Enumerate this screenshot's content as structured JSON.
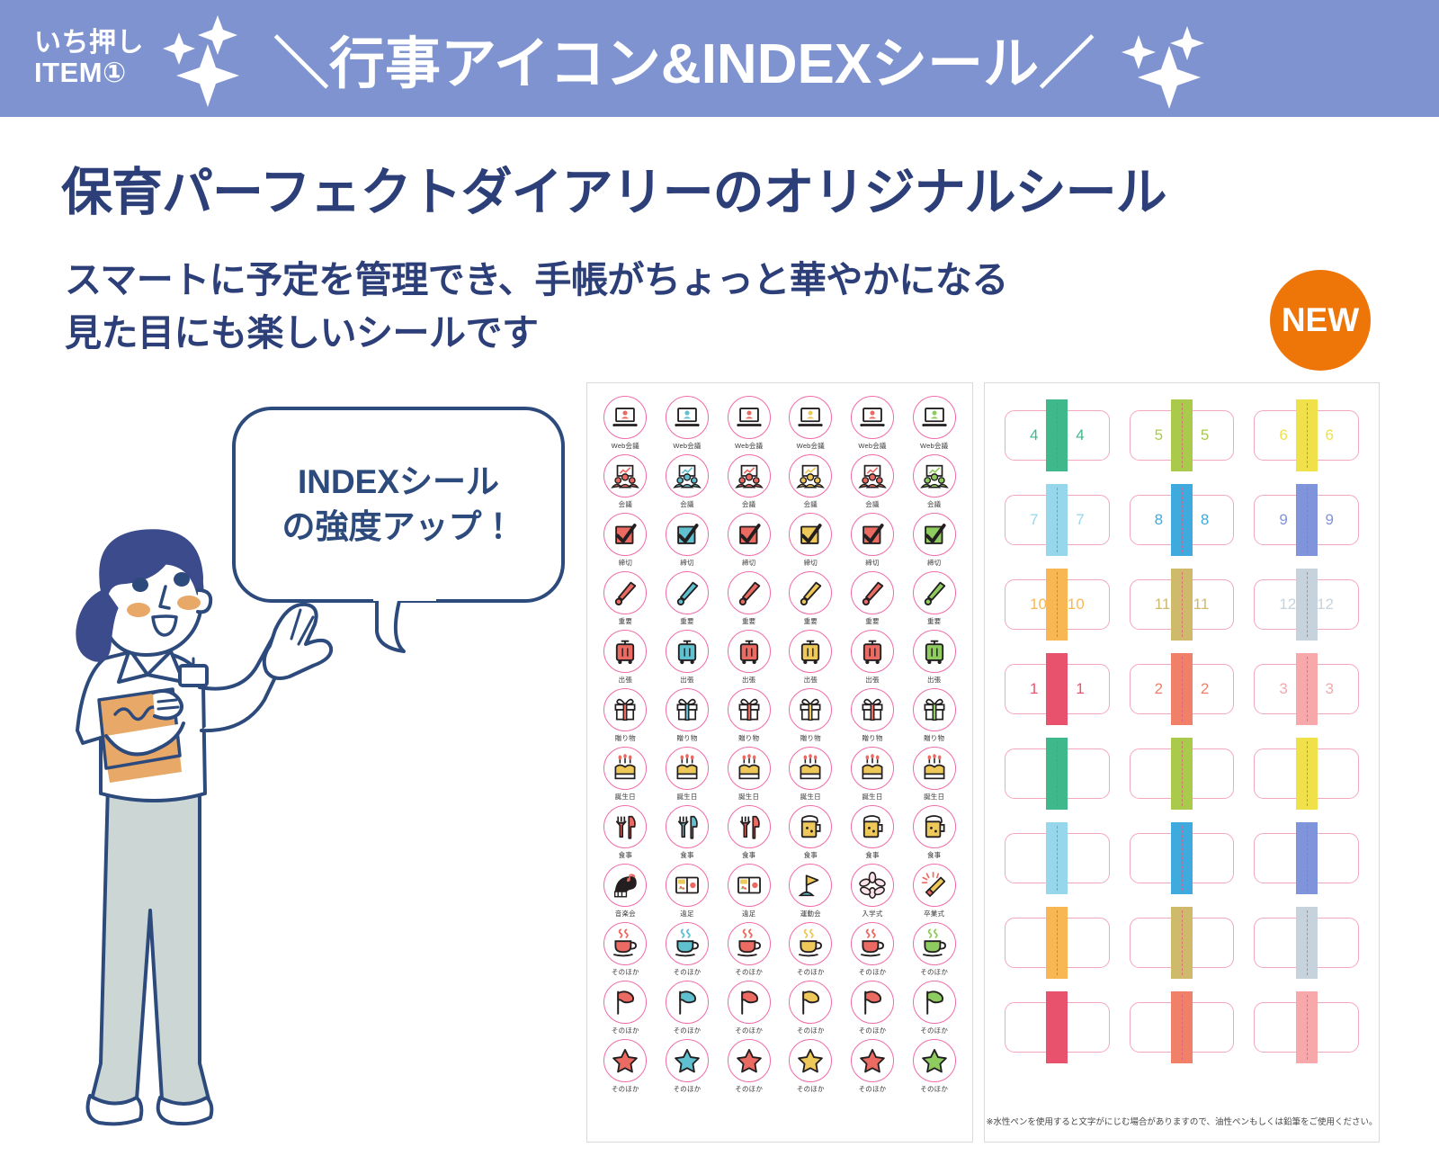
{
  "header": {
    "badge_line1": "いち押し",
    "badge_line2": "ITEM①",
    "title": "行事アイコン&INDEXシール",
    "slash_open": "＼",
    "slash_close": "／",
    "band_color": "#7e93cf"
  },
  "main": {
    "headline": "保育パーフェクトダイアリーのオリジナルシール",
    "sub_line1": "スマートに予定を管理でき、手帳がちょっと華やかになる",
    "sub_line2": "見た目にも楽しいシールです",
    "new_badge": "NEW",
    "new_badge_color": "#ee7508",
    "heading_color": "#2d3f78"
  },
  "bubble": {
    "line1": "INDEXシール",
    "line2": "の強度アップ！",
    "border_color": "#2d4a7c"
  },
  "icon_sheet": {
    "circle_color": "#f06ba8",
    "palette": [
      "#eb6a62",
      "#5fc0cf",
      "#eb6a62",
      "#eec95a",
      "#eb6a62",
      "#8fcc5f"
    ],
    "rows": [
      {
        "type": "laptop",
        "labels": [
          "Web会議",
          "Web会議",
          "Web会議",
          "Web会議",
          "Web会議",
          "Web会議"
        ]
      },
      {
        "type": "meeting",
        "labels": [
          "会議",
          "会議",
          "会議",
          "会議",
          "会議",
          "会議"
        ]
      },
      {
        "type": "check",
        "labels": [
          "締切",
          "締切",
          "締切",
          "締切",
          "締切",
          "締切"
        ]
      },
      {
        "type": "exclaim",
        "labels": [
          "重要",
          "重要",
          "重要",
          "重要",
          "重要",
          "重要"
        ]
      },
      {
        "type": "suitcase",
        "labels": [
          "出張",
          "出張",
          "出張",
          "出張",
          "出張",
          "出張"
        ]
      },
      {
        "type": "gift",
        "labels": [
          "贈り物",
          "贈り物",
          "贈り物",
          "贈り物",
          "贈り物",
          "贈り物"
        ]
      },
      {
        "type": "cake",
        "labels": [
          "誕生日",
          "誕生日",
          "誕生日",
          "誕生日",
          "誕生日",
          "誕生日"
        ]
      },
      {
        "type": "mixed-meal",
        "labels": [
          "食事",
          "食事",
          "食事",
          "食事",
          "食事",
          "食事"
        ]
      },
      {
        "type": "events",
        "labels": [
          "音楽会",
          "遠足",
          "遠足",
          "運動会",
          "入学式",
          "卒業式"
        ]
      },
      {
        "type": "cup",
        "labels": [
          "そのほか",
          "そのほか",
          "そのほか",
          "そのほか",
          "そのほか",
          "そのほか"
        ]
      },
      {
        "type": "flag",
        "labels": [
          "そのほか",
          "そのほか",
          "そのほか",
          "そのほか",
          "そのほか",
          "そのほか"
        ]
      },
      {
        "type": "star",
        "labels": [
          "そのほか",
          "そのほか",
          "そのほか",
          "そのほか",
          "そのほか",
          "そのほか"
        ]
      }
    ]
  },
  "index_sheet": {
    "card_border_color": "#f3a7bb",
    "note": "※水性ペンを使用すると文字がにじむ場合がありますので、油性ペンもしくは鉛筆をご使用ください。",
    "cells": [
      {
        "number": "4",
        "color": "#3fb98b"
      },
      {
        "number": "5",
        "color": "#a9ca4b"
      },
      {
        "number": "6",
        "color": "#f0e14a"
      },
      {
        "number": "7",
        "color": "#96d7ec"
      },
      {
        "number": "8",
        "color": "#3eaade"
      },
      {
        "number": "9",
        "color": "#8094dc"
      },
      {
        "number": "10",
        "color": "#f9b753"
      },
      {
        "number": "11",
        "color": "#cfb96a"
      },
      {
        "number": "12",
        "color": "#c6d3dd"
      },
      {
        "number": "1",
        "color": "#e8526c"
      },
      {
        "number": "2",
        "color": "#f08068"
      },
      {
        "number": "3",
        "color": "#f6a8ab"
      },
      {
        "number": "",
        "color": "#3fb98b"
      },
      {
        "number": "",
        "color": "#a9ca4b"
      },
      {
        "number": "",
        "color": "#f0e14a"
      },
      {
        "number": "",
        "color": "#96d7ec"
      },
      {
        "number": "",
        "color": "#3eaade"
      },
      {
        "number": "",
        "color": "#8094dc"
      },
      {
        "number": "",
        "color": "#f9b753"
      },
      {
        "number": "",
        "color": "#cfb96a"
      },
      {
        "number": "",
        "color": "#c6d3dd"
      },
      {
        "number": "",
        "color": "#e8526c"
      },
      {
        "number": "",
        "color": "#f08068"
      },
      {
        "number": "",
        "color": "#f6a8ab"
      }
    ]
  }
}
